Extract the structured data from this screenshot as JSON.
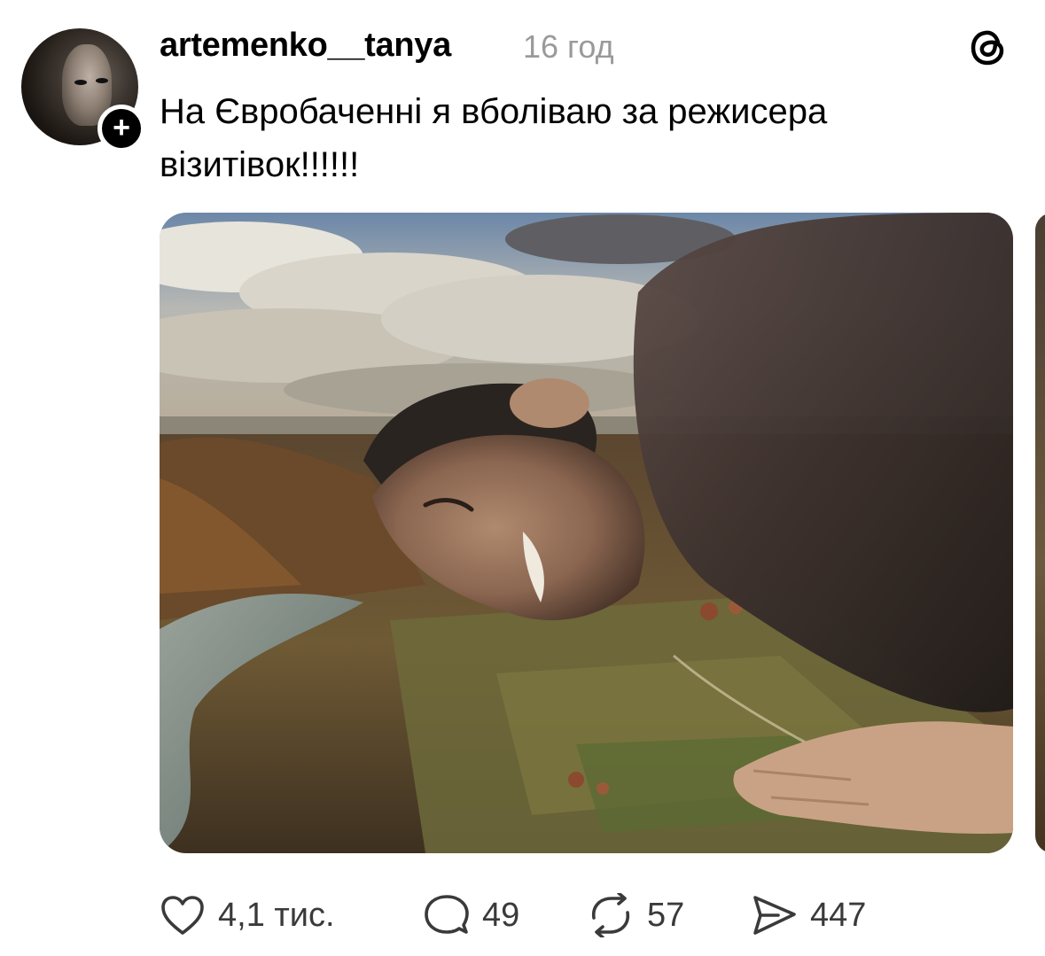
{
  "post": {
    "author": "artemenko__tanya",
    "time": "16 год",
    "text": "На Євробаченні я вболіваю за режисера візитівок!!!!!!",
    "follow_glyph": "+",
    "platform_icon": "threads-logo-icon"
  },
  "actions": {
    "like": {
      "icon": "heart-icon",
      "count": "4,1 тис."
    },
    "reply": {
      "icon": "comment-icon",
      "count": "49"
    },
    "repost": {
      "icon": "repost-icon",
      "count": "57"
    },
    "share": {
      "icon": "send-icon",
      "count": "447"
    }
  },
  "colors": {
    "text": "#000000",
    "muted": "#9a9a9a",
    "icon": "#3a3a3a"
  }
}
